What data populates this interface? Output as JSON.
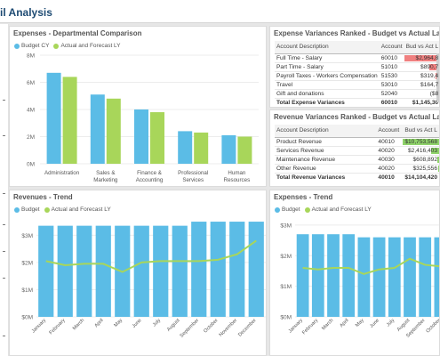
{
  "page": {
    "title": "il Analysis"
  },
  "colors": {
    "budget": "#5bbce6",
    "actual": "#a8d65a",
    "neg": "#f08080",
    "pos": "#8fd36a",
    "title": "#1e4b73"
  },
  "expenses_comparison": {
    "title": "Expenses - Departmental Comparison",
    "legend": [
      "Budget CY",
      "Actual and Forecast LY"
    ],
    "chart_data": {
      "type": "bar",
      "categories": [
        "Administration",
        "Sales & Marketing",
        "Finance & Accounting",
        "Professional Services",
        "Human Resources"
      ],
      "category_lines": [
        [
          "Administration"
        ],
        [
          "Sales &",
          "Marketing"
        ],
        [
          "Finance &",
          "Accounting"
        ],
        [
          "Professional",
          "Services"
        ],
        [
          "Human",
          "Resources"
        ]
      ],
      "series": [
        {
          "name": "Budget CY",
          "values": [
            6.7,
            5.1,
            4.0,
            2.4,
            2.1
          ]
        },
        {
          "name": "Actual and Forecast LY",
          "values": [
            6.4,
            4.8,
            3.8,
            2.3,
            2.0
          ]
        }
      ],
      "ylim": [
        0,
        8
      ],
      "yticks": [
        "0M",
        "2M",
        "4M",
        "6M",
        "8M"
      ],
      "ytick_values": [
        0,
        2,
        4,
        6,
        8
      ]
    }
  },
  "expense_variances": {
    "title": "Expense Variances Ranked - Budget vs Actual Last Year",
    "columns": [
      "Account Description",
      "Account",
      "Bud vs Act L"
    ],
    "rows": [
      {
        "desc": "Full Time - Salary",
        "account": "60010",
        "value": "$2,964,8",
        "frac": 1.0
      },
      {
        "desc": "Part Time - Salary",
        "account": "51010",
        "value": "$890,7",
        "frac": 0.3
      },
      {
        "desc": "Payroll Taxes - Workers Compensation",
        "account": "51530",
        "value": "$319,4",
        "frac": 0.12
      },
      {
        "desc": "Travel",
        "account": "53010",
        "value": "$164,7",
        "frac": 0.06
      },
      {
        "desc": "Gift and donations",
        "account": "52040",
        "value": "($8",
        "frac": 0.0
      }
    ],
    "total": {
      "desc": "Total Expense Variances",
      "account": "60010",
      "value": "$1,145,30"
    }
  },
  "revenue_variances": {
    "title": "Revenue Variances Ranked - Budget vs Actual Last Year",
    "columns": [
      "Account Description",
      "Account",
      "Bud vs Act L"
    ],
    "rows": [
      {
        "desc": "Product Revenue",
        "account": "40010",
        "value": "$10,753,568",
        "frac": 1.0
      },
      {
        "desc": "Services Revenue",
        "account": "40020",
        "value": "$2,416,403",
        "frac": 0.22
      },
      {
        "desc": "Maintenance Revenue",
        "account": "40030",
        "value": "$608,892",
        "frac": 0.06
      },
      {
        "desc": "Other Revenue",
        "account": "40020",
        "value": "$325,556",
        "frac": 0.03
      }
    ],
    "total": {
      "desc": "Total Revenue Variances",
      "account": "40010",
      "value": "$14,104,420"
    }
  },
  "revenues_trend": {
    "title": "Revenues - Trend",
    "legend": [
      "Budget",
      "Actual and Forecast LY"
    ],
    "chart_data": {
      "type": "bar",
      "categories": [
        "January",
        "February",
        "March",
        "April",
        "May",
        "June",
        "July",
        "August",
        "September",
        "October",
        "November",
        "December"
      ],
      "series": [
        {
          "name": "Budget",
          "values": [
            3.35,
            3.35,
            3.35,
            3.35,
            3.35,
            3.35,
            3.35,
            3.35,
            3.5,
            3.5,
            3.5,
            3.5
          ]
        },
        {
          "name": "Actual and Forecast LY",
          "values": [
            2.05,
            1.9,
            1.95,
            1.95,
            1.65,
            2.0,
            2.05,
            2.05,
            2.05,
            2.1,
            2.3,
            2.8
          ]
        }
      ],
      "ylim": [
        0,
        3.6
      ],
      "yticks": [
        "$0M",
        "$1M",
        "$2M",
        "$3M"
      ],
      "ytick_values": [
        0,
        1,
        2,
        3
      ]
    }
  },
  "expenses_trend": {
    "title": "Expenses - Trend",
    "legend": [
      "Budget",
      "Actual and Forecast LY"
    ],
    "chart_data": {
      "type": "bar",
      "categories": [
        "January",
        "February",
        "March",
        "April",
        "May",
        "June",
        "July",
        "August",
        "September",
        "October"
      ],
      "series": [
        {
          "name": "Budget",
          "values": [
            2.7,
            2.7,
            2.7,
            2.7,
            2.6,
            2.6,
            2.6,
            2.6,
            2.6,
            2.6
          ]
        },
        {
          "name": "Actual and Forecast LY",
          "values": [
            1.6,
            1.55,
            1.6,
            1.6,
            1.4,
            1.55,
            1.6,
            1.9,
            1.7,
            1.65
          ]
        }
      ],
      "ylim": [
        0,
        3.2
      ],
      "yticks": [
        "$0M",
        "$1M",
        "$2M",
        "$3M"
      ],
      "ytick_values": [
        0,
        1,
        2,
        3
      ]
    }
  }
}
